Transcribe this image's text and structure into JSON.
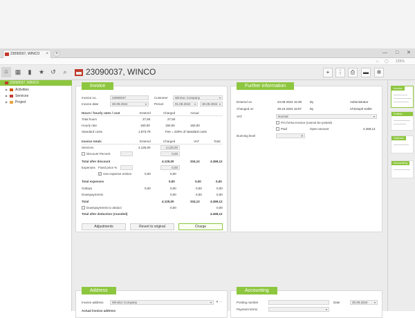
{
  "browser": {
    "tab_title": "23090037, WINCO",
    "new_tab": "+",
    "minimize": "—",
    "maximize": "□",
    "close": "✕",
    "zoom": "125%"
  },
  "app": {
    "title": "23090037, WINCO"
  },
  "sidebar": {
    "root": "23090037, WINCO",
    "items": [
      {
        "label": "Activities"
      },
      {
        "label": "Services"
      },
      {
        "label": "Project"
      }
    ]
  },
  "invoice": {
    "title": "Invoice",
    "invoice_no_label": "Invoice no.",
    "invoice_no": "23090037",
    "customer_label": "Customer",
    "customer": "WinSoc Company",
    "invoice_date_label": "Invoice date",
    "invoice_date": "30.09.2024",
    "period_label": "Period",
    "period_from": "01.09.2024",
    "period_to": "30.09.2024",
    "hours_header": "Hours / hourly rates / cost",
    "col_entered": "Entered",
    "col_charged": "Charged",
    "col_actual": "Actual",
    "total_hours_label": "Total hours",
    "total_hours_entered": "27,50",
    "total_hours_charged": "27,50",
    "hourly_rate_label": "Hourly rate",
    "hourly_rate_entered": "150,00",
    "hourly_rate_charged": "150,00",
    "hourly_rate_actual": "150,00",
    "standard_costs_label": "Standard costs",
    "standard_costs_entered": "1.873,79",
    "standard_costs_note": "Fee = 220% of standard costs",
    "totals_header": "Invoice totals",
    "col_vat": "VAT",
    "col_total": "Total",
    "services_label": "Services",
    "services_entered": "4.125,00",
    "services_charged": "4.125,00",
    "discount_label": "Discount Percent",
    "discount_charged": "0,00",
    "total_after_discount_label": "Total after discount",
    "tad_charged": "4.125,00",
    "tad_vat": "334,12",
    "tad_total": "4.459,12",
    "expenses_label": "Expenses",
    "fixed_price_label": "Fixed price %",
    "fixed_price_charged": "0,00",
    "use_expense_label": "Use expense entries",
    "use_expense_entered": "0,00",
    "use_expense_charged": "0,00",
    "total_expenses_label": "Total expenses",
    "te_charged": "0,00",
    "te_vat": "0,00",
    "te_total": "0,00",
    "outlays_label": "Outlays",
    "outlays_entered": "0,00",
    "outlays_charged": "0,00",
    "outlays_vat": "0,00",
    "outlays_total": "0,00",
    "downpayments_label": "Downpayments",
    "downpayments_charged": "0,00",
    "downpayments_vat": "0,00",
    "downpayments_total": "0,00",
    "total_label": "Total",
    "total_charged": "4.125,00",
    "total_vat": "334,12",
    "total_total": "4.459,12",
    "dp_deduct_label": "Downpayments to deduct",
    "dp_deduct_charged": "0,00",
    "dp_deduct_total": "0,00",
    "total_after_deduction_label": "Total after deduction (rounded)",
    "tadr_total": "4.459,12",
    "btn_adjustments": "Adjustments",
    "btn_revert": "Revert to original",
    "btn_charge": "Charge"
  },
  "further": {
    "title": "Further information",
    "entered_on_label": "Entered on",
    "entered_on": "23.09.2024 15:39",
    "by1_label": "By",
    "by1": "Administrator",
    "changed_on_label": "Changed on",
    "changed_on": "29.10.2024 15:57",
    "by2_label": "By",
    "by2": "Christoph Keller",
    "vat_label": "VAT",
    "vat": "Normal",
    "pro_forma_label": "Pro forma Invoice (cannot be posted)",
    "paid_label": "Paid",
    "open_amount_label": "Open amount",
    "open_amount": "4.459,12",
    "dunning_label": "Dunning level",
    "dunning": "0"
  },
  "address": {
    "title": "Address",
    "invoice_address_label": "Invoice address",
    "invoice_address": "Winsloc Company",
    "actual_label": "Actual invoice address"
  },
  "accounting": {
    "title": "Accounting",
    "posting_label": "Posting number",
    "date_label": "Date",
    "date": "30.09.2024",
    "payment_terms_label": "Payment terms"
  },
  "rightbar": {
    "thumbs": [
      "Invoice",
      "Further Infor...",
      "Address",
      "Accounting"
    ]
  }
}
